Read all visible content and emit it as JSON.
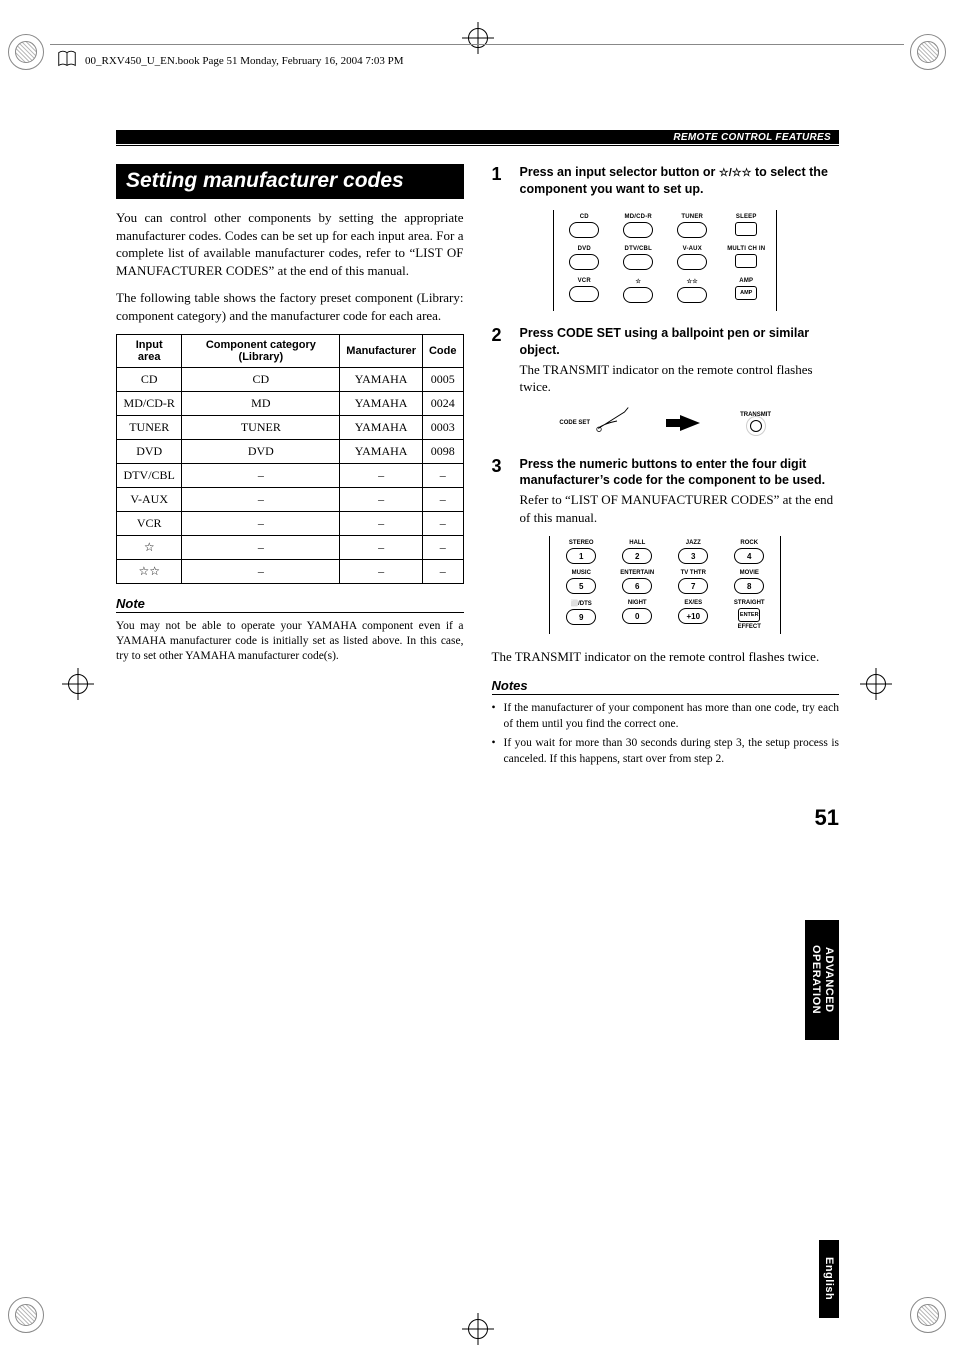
{
  "header": {
    "file_info": "00_RXV450_U_EN.book  Page 51  Monday, February 16, 2004  7:03 PM"
  },
  "bar_label": "REMOTE CONTROL FEATURES",
  "section_title": "Setting manufacturer codes",
  "intro_p1": "You can control other components by setting the appropriate manufacturer codes. Codes can be set up for each input area. For a complete list of available manufacturer codes, refer to “LIST OF MANUFACTURER CODES” at the end of this manual.",
  "intro_p2": "The following table shows the factory preset component (Library: component category) and the manufacturer code for each area.",
  "table": {
    "headers": [
      "Input area",
      "Component category (Library)",
      "Manufacturer",
      "Code"
    ],
    "rows": [
      [
        "CD",
        "CD",
        "YAMAHA",
        "0005"
      ],
      [
        "MD/CD-R",
        "MD",
        "YAMAHA",
        "0024"
      ],
      [
        "TUNER",
        "TUNER",
        "YAMAHA",
        "0003"
      ],
      [
        "DVD",
        "DVD",
        "YAMAHA",
        "0098"
      ],
      [
        "DTV/CBL",
        "–",
        "–",
        "–"
      ],
      [
        "V-AUX",
        "–",
        "–",
        "–"
      ],
      [
        "VCR",
        "–",
        "–",
        "–"
      ],
      [
        "☆",
        "–",
        "–",
        "–"
      ],
      [
        "☆☆",
        "–",
        "–",
        "–"
      ]
    ]
  },
  "note_label": "Note",
  "note_text": "You may not be able to operate your YAMAHA component even if a YAMAHA manufacturer code is initially set as listed above. In this case, try to set other YAMAHA manufacturer code(s).",
  "steps": {
    "s1": {
      "num": "1",
      "title_a": "Press an input selector button or ",
      "title_b": " to select the component you want to set up.",
      "stars": "☆/☆☆"
    },
    "s2": {
      "num": "2",
      "title": "Press CODE SET using a ballpoint pen or similar object.",
      "text": "The TRANSMIT indicator on the remote control flashes twice."
    },
    "s3": {
      "num": "3",
      "title": "Press the numeric buttons to enter the four digit manufacturer’s code for the component to be used.",
      "text": "Refer to “LIST OF MANUFACTURER CODES” at the end of this manual.",
      "after": "The TRANSMIT indicator on the remote control flashes twice."
    }
  },
  "notes_label": "Notes",
  "notes": [
    "If the manufacturer of your component has more than one code, try each of them until you find the correct one.",
    "If you wait for more than 30 seconds during step 3, the setup process is canceled. If this happens, start over from step 2."
  ],
  "input_buttons": {
    "row1": [
      "CD",
      "MD/CD-R",
      "TUNER",
      "SLEEP"
    ],
    "row2": [
      "DVD",
      "DTV/CBL",
      "V-AUX",
      "MULTI CH IN"
    ],
    "row3": [
      "VCR",
      "☆",
      "☆☆",
      "AMP"
    ]
  },
  "codeset_label": "CODE SET",
  "transmit_label": "TRANSMIT",
  "num_buttons": {
    "top": [
      "STEREO",
      "HALL",
      "JAZZ",
      "ROCK",
      "MUSIC",
      "ENTERTAIN",
      "TV THTR",
      "MOVIE",
      "⬜/DTS",
      "NIGHT",
      "EX/ES",
      "STRAIGHT"
    ],
    "nums": [
      "1",
      "2",
      "3",
      "4",
      "5",
      "6",
      "7",
      "8",
      "9",
      "0",
      "+10",
      "ENTER"
    ],
    "bottom": "EFFECT"
  },
  "side": {
    "adv": "ADVANCED OPERATION",
    "eng": "English"
  },
  "page_number": "51"
}
